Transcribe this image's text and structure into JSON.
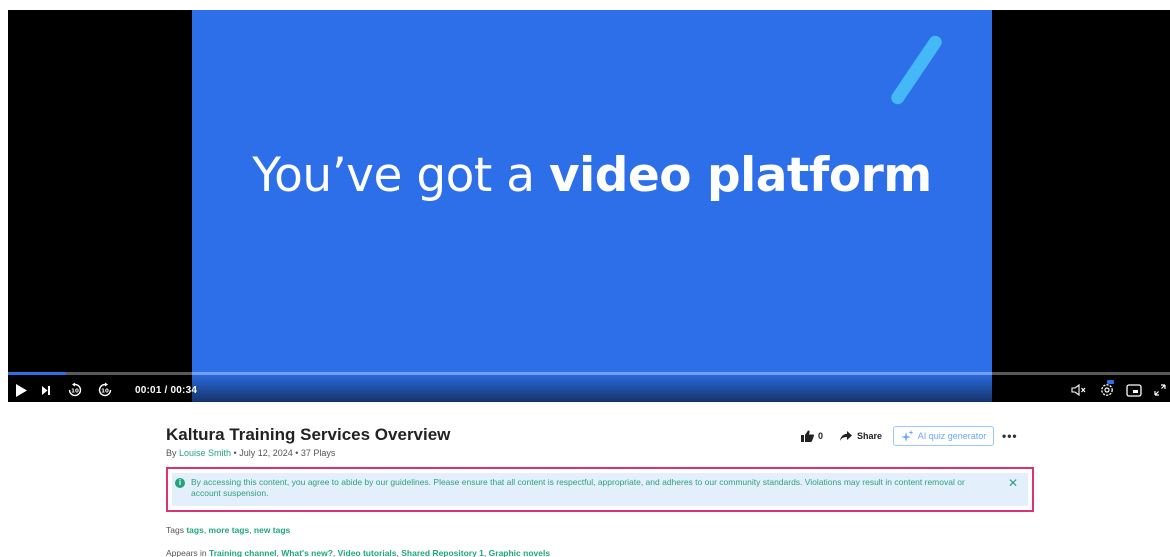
{
  "video": {
    "slide_text_light": "You’ve got a ",
    "slide_text_bold": "video platform",
    "time_display": "00:01 / 00:34",
    "progress_fraction": 0.05
  },
  "media": {
    "title": "Kaltura Training Services Overview",
    "by_prefix": "By ",
    "author": "Louise Smith",
    "date": "July 12, 2024",
    "plays": "37 Plays",
    "separator": " • "
  },
  "actions": {
    "like_count": "0",
    "share_label": "Share",
    "quiz_label": "AI quiz generator",
    "more_label": "•••"
  },
  "notice": {
    "text": "By accessing this content, you agree to abide by our guidelines. Please ensure that all content is respectful, appropriate, and adheres to our community standards. Violations may result in content removal or account suspension.",
    "close": "✕"
  },
  "tags": {
    "label": "Tags ",
    "items": [
      "tags",
      "more tags",
      "new tags"
    ]
  },
  "appears_in": {
    "label": "Appears in ",
    "items": [
      "Training channel",
      "What's new?",
      "Video tutorials",
      "Shared Repository 1",
      "Graphic novels"
    ]
  },
  "colors": {
    "slide_blue": "#2c6fe9",
    "accent_light_blue": "#45b8f7",
    "link_green": "#1fa87b",
    "notice_border": "#d9347a"
  }
}
